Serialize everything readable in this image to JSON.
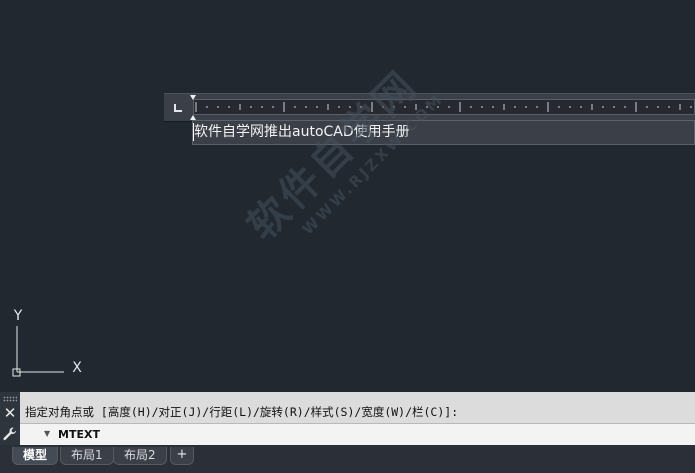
{
  "editor": {
    "text": "软件自学网推出autoCAD使用手册"
  },
  "watermark": {
    "main": "软件自学网",
    "url": "WWW.RJZXW.COM"
  },
  "ucs": {
    "x_label": "X",
    "y_label": "Y"
  },
  "command_line": {
    "history": "指定对角点或 [高度(H)/对正(J)/行距(L)/旋转(R)/样式(S)/宽度(W)/栏(C)]:",
    "prompt": "MTEXT",
    "close_icon": "close-icon",
    "customize_icon": "wrench-icon"
  },
  "tabs": {
    "items": [
      {
        "label": "模型"
      },
      {
        "label": "布局1"
      },
      {
        "label": "布局2"
      }
    ],
    "add_label": "+"
  }
}
